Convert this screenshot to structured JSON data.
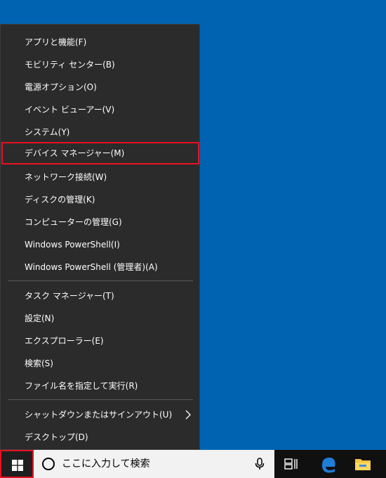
{
  "menu": {
    "items": [
      {
        "label": "アプリと機能(F)"
      },
      {
        "label": "モビリティ センター(B)"
      },
      {
        "label": "電源オプション(O)"
      },
      {
        "label": "イベント ビューアー(V)"
      },
      {
        "label": "システム(Y)"
      },
      {
        "label": "デバイス マネージャー(M)"
      },
      {
        "label": "ネットワーク接続(W)"
      },
      {
        "label": "ディスクの管理(K)"
      },
      {
        "label": "コンピューターの管理(G)"
      },
      {
        "label": "Windows PowerShell(I)"
      },
      {
        "label": "Windows PowerShell (管理者)(A)"
      },
      {
        "label": "タスク マネージャー(T)"
      },
      {
        "label": "設定(N)"
      },
      {
        "label": "エクスプローラー(E)"
      },
      {
        "label": "検索(S)"
      },
      {
        "label": "ファイル名を指定して実行(R)"
      },
      {
        "label": "シャットダウンまたはサインアウト(U)"
      },
      {
        "label": "デスクトップ(D)"
      }
    ],
    "highlight_color": "#e81123",
    "background_color": "#2b2b2b"
  },
  "taskbar": {
    "search_placeholder": "ここに入力して検索",
    "icons": [
      "windows-logo-icon",
      "search-circle-icon",
      "microphone-icon",
      "task-view-icon",
      "edge-icon",
      "file-explorer-icon"
    ]
  },
  "colors": {
    "desktop": "#0063b1",
    "taskbar": "#101010",
    "edge_blue": "#1e7fd8",
    "folder_yellow": "#f5c342"
  }
}
